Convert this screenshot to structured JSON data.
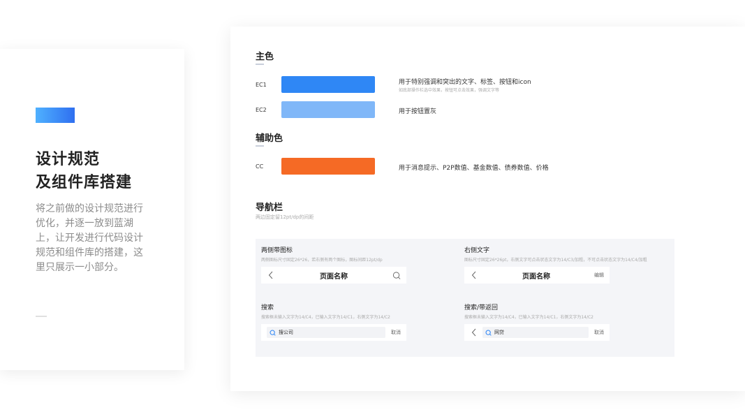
{
  "intro": {
    "title_line1": "设计规范",
    "title_line2": "及组件库搭建",
    "description": "将之前做的设计规范进行优化，并逐一放到蓝湖上，让开发进行代码设计规范和组件库的搭建，这里只展示一小部分。"
  },
  "primary": {
    "title": "主色",
    "colors": [
      {
        "code": "EC1",
        "hex": "#2f87f5",
        "desc": "用于特别强调和突出的文字、标签、按钮和icon",
        "note": "如底部操作栏选中效果，按钮可点击效果，强调文字等"
      },
      {
        "code": "EC2",
        "hex": "#80b7f8",
        "desc": "用于按钮置灰",
        "note": ""
      }
    ]
  },
  "secondary": {
    "title": "辅助色",
    "colors": [
      {
        "code": "CC",
        "hex": "#f56a25",
        "desc": "用于消息提示、P2P数值、基金数值、债券数值、价格",
        "note": ""
      }
    ]
  },
  "navbar": {
    "title": "导航栏",
    "subtitle": "两边固定留12pt/dp的间距",
    "demos": {
      "both_icons": {
        "title": "两侧带图标",
        "note": "两侧图标尺寸固定26*26，若右侧有两个图标，图标间距12pt/dp",
        "page_name": "页面名称"
      },
      "right_text": {
        "title": "右侧文字",
        "note": "图标尺寸固定26*26pt，右侧文字可点击状态文字为14/C3/加粗，不可点击状态文字为14/C4/加粗",
        "page_name": "页面名称",
        "right_label": "编辑"
      },
      "search": {
        "title": "搜索",
        "note": "搜索框未输入文字为14/C4，已输入文字为14/C1，右侧文字为14/C2",
        "query": "搜公司",
        "cancel": "取消"
      },
      "search_back": {
        "title": "搜索/带返回",
        "note": "搜索框未输入文字为14/C4，已输入文字为14/C1，右侧文字为14/C2",
        "query": "网贷",
        "cancel": "取消"
      }
    }
  }
}
